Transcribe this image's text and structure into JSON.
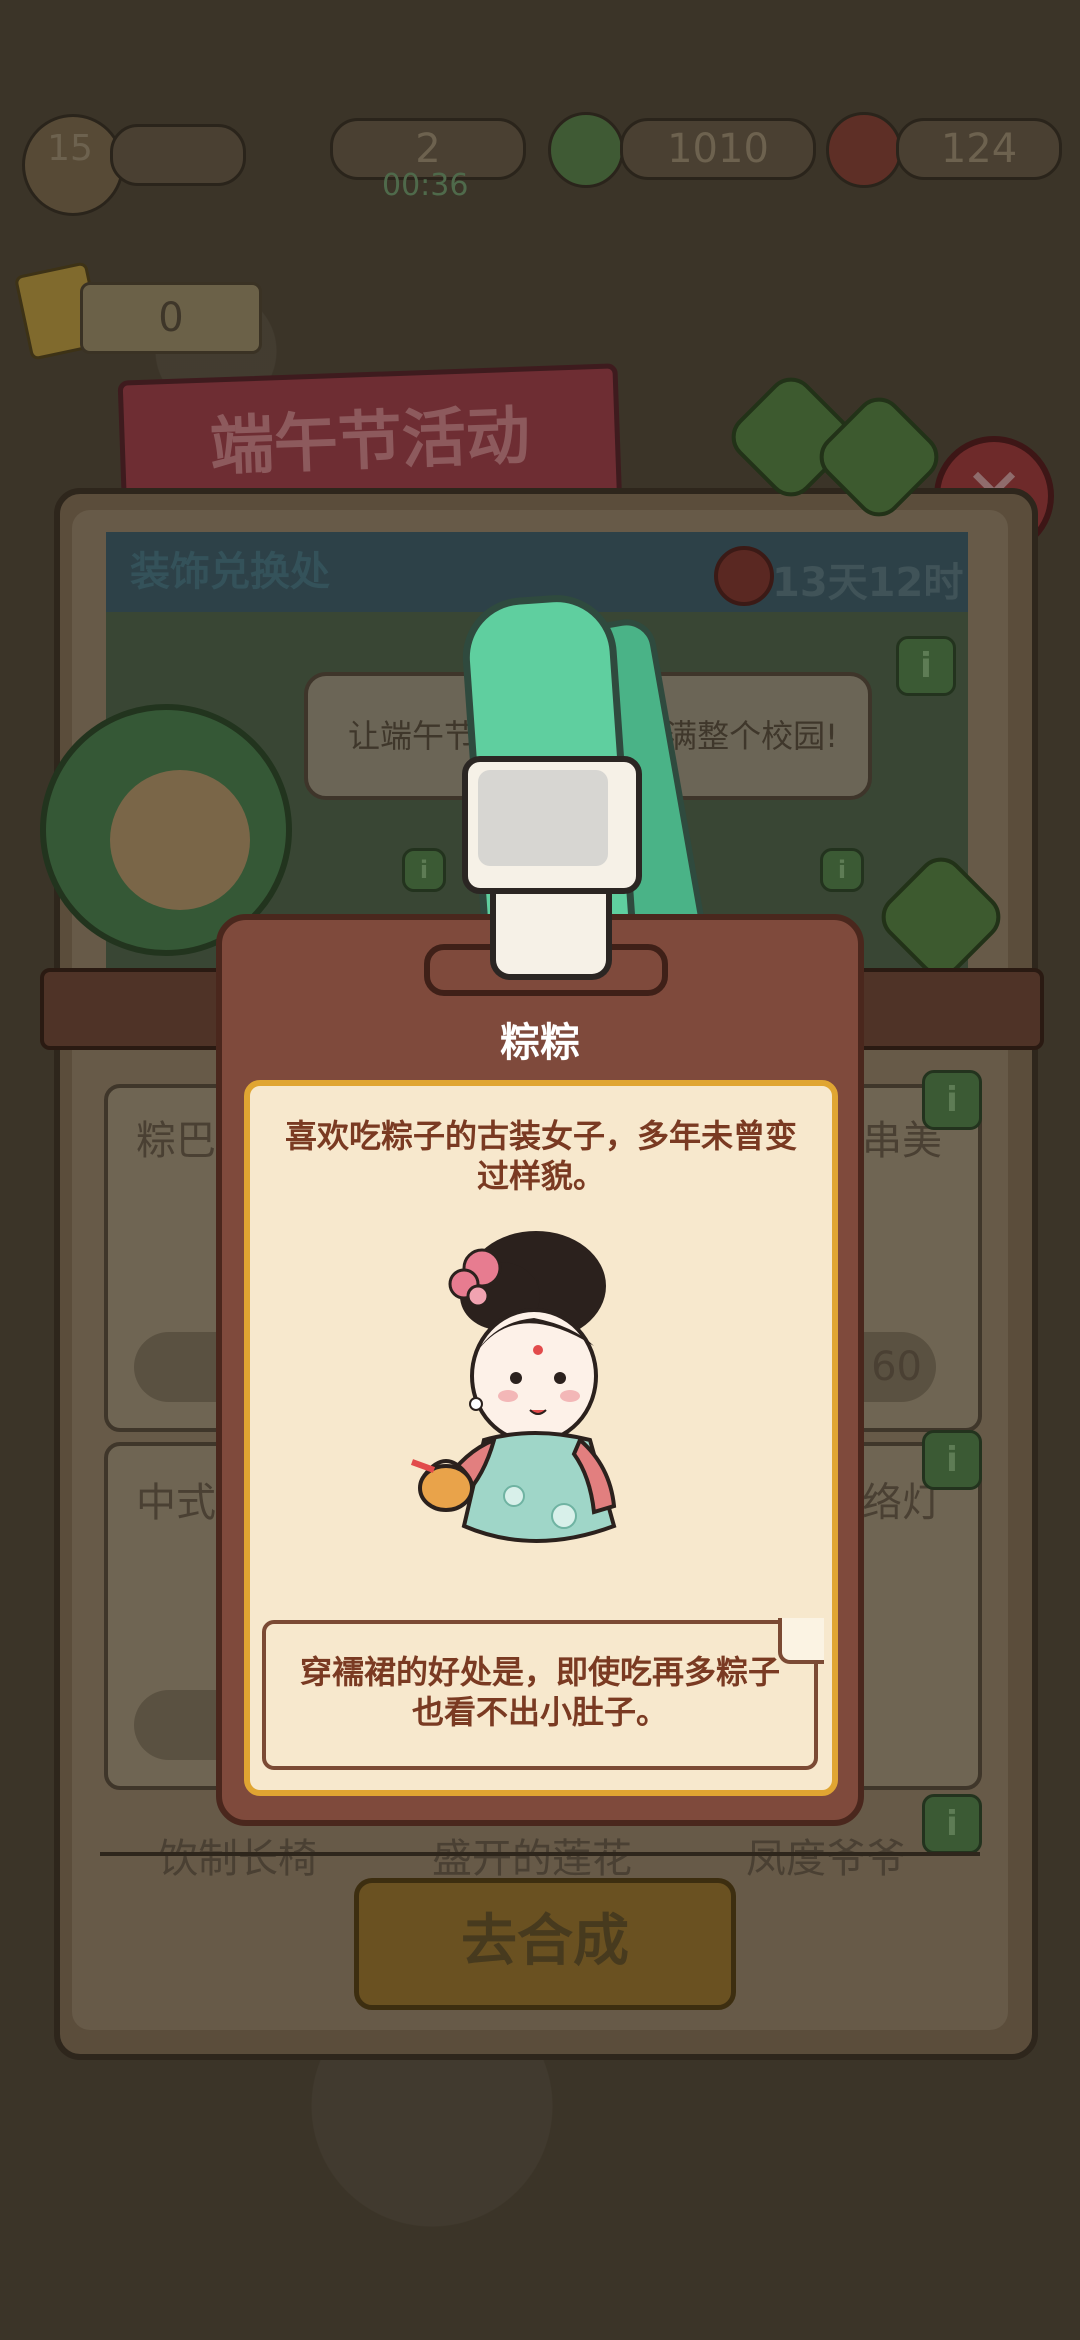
{
  "hud": {
    "level": "15",
    "energy_count": "2",
    "energy_timer": "00:36",
    "cash": "1010",
    "gems": "124",
    "tickets": "0"
  },
  "event": {
    "title": "端午节活动",
    "section_header": "装饰兑换处",
    "timer": "13天12时",
    "speech_left": "让端午节",
    "speech_right": "满整个校园!"
  },
  "background_cards": [
    {
      "title": "粽巴"
    },
    {
      "title": "串美"
    },
    {
      "title": "中式"
    },
    {
      "title": "络灯"
    },
    {
      "title": "饮制长椅"
    },
    {
      "title": "盛开的莲花"
    },
    {
      "title": "凤度爷爷"
    }
  ],
  "background_card_price": "60",
  "go_button": "去合成",
  "modal": {
    "name": "粽粽",
    "description": "喜欢吃粽子的古装女子，多年未曾变过样貌。",
    "note": "穿襦裙的好处是，即使吃再多粽子也看不出小肚子。"
  },
  "colors": {
    "modal_bg": "#7f4a3c",
    "paper_bg": "#f7e8cd",
    "paper_border": "#e0a532",
    "text_brown": "#7a3a22",
    "strap_green": "#5fcf9f"
  }
}
